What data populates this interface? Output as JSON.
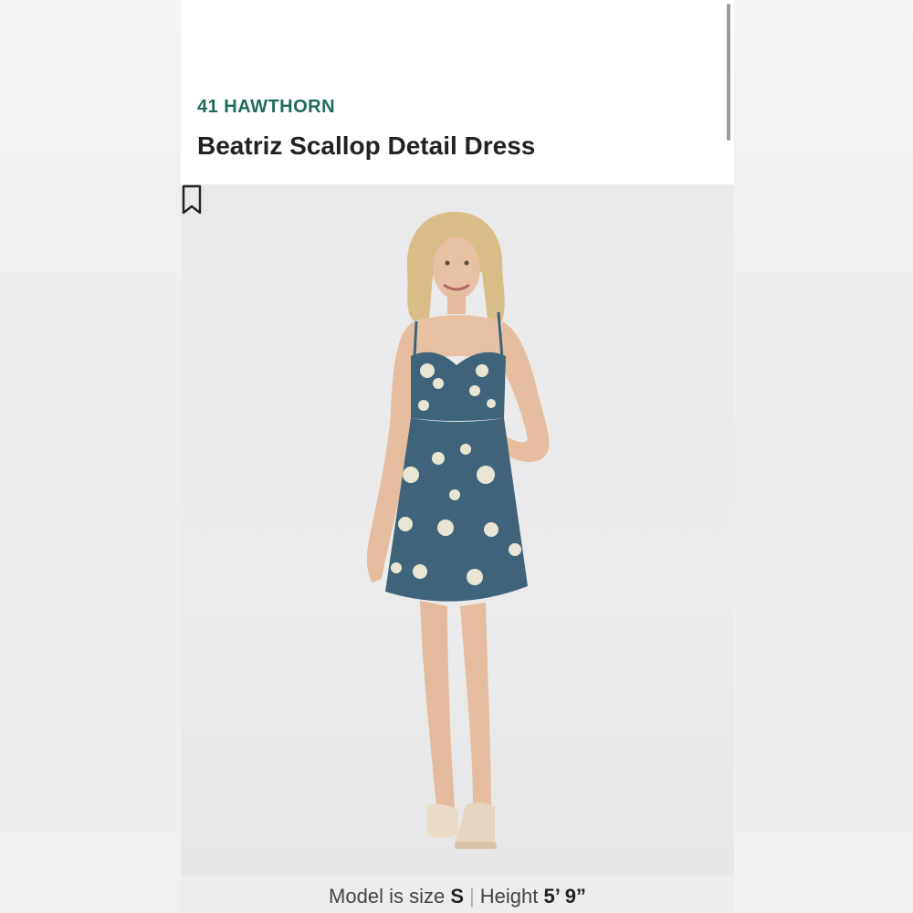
{
  "product": {
    "brand": "41 HAWTHORN",
    "name": "Beatriz Scallop Detail Dress"
  },
  "photo": {
    "bookmark_icon": "bookmark-icon",
    "alt": "model wearing dress"
  },
  "model_info": {
    "size_prefix": "Model is size",
    "size_value": "S",
    "separator": "|",
    "height_prefix": "Height",
    "height_value": "5’ 9”"
  },
  "colors": {
    "brand": "#1f6b5c",
    "dress": "#3f6479",
    "background": "#ffffff"
  }
}
